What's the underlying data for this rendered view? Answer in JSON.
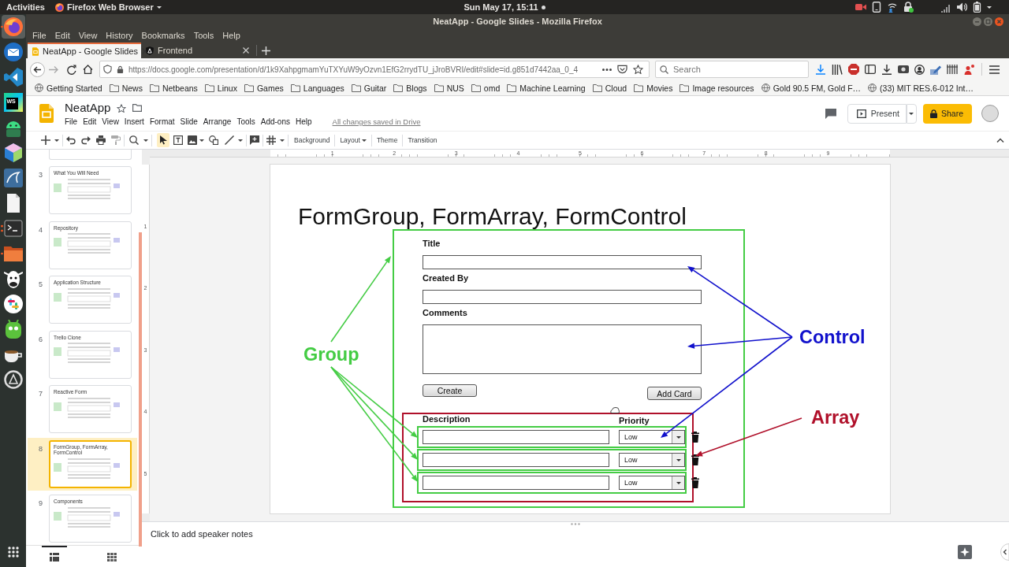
{
  "system_bar": {
    "activities": "Activities",
    "app_menu": "Firefox Web Browser",
    "clock": "Sun May 17, 15:11"
  },
  "dock": {
    "apps": [
      {
        "kind": "browser",
        "running": true,
        "multiple_windows": false,
        "selected": true
      },
      {
        "kind": "mail",
        "running": false,
        "multiple_windows": false,
        "selected": false
      },
      {
        "kind": "code-editor",
        "running": false,
        "multiple_windows": false,
        "selected": false
      },
      {
        "kind": "ide",
        "label": "WS",
        "running": false,
        "multiple_windows": false,
        "selected": false
      },
      {
        "kind": "android",
        "running": false,
        "multiple_windows": false,
        "selected": false
      },
      {
        "kind": "cube",
        "running": false,
        "multiple_windows": false,
        "selected": false
      },
      {
        "kind": "database",
        "running": false,
        "multiple_windows": false,
        "selected": false
      },
      {
        "kind": "document",
        "running": false,
        "multiple_windows": false,
        "selected": false
      },
      {
        "kind": "terminal",
        "running": true,
        "multiple_windows": true,
        "selected": false
      },
      {
        "kind": "files",
        "running": true,
        "multiple_windows": false,
        "selected": false
      },
      {
        "kind": "cow",
        "running": false,
        "multiple_windows": false,
        "selected": false
      },
      {
        "kind": "chat",
        "running": false,
        "multiple_windows": false,
        "selected": false
      },
      {
        "kind": "robot",
        "running": false,
        "multiple_windows": false,
        "selected": false
      },
      {
        "kind": "cup",
        "running": false,
        "multiple_windows": false,
        "selected": false
      },
      {
        "kind": "updater",
        "running": false,
        "multiple_windows": false,
        "selected": false
      }
    ]
  },
  "browser": {
    "window_title": "NeatApp - Google Slides - Mozilla Firefox",
    "menu": [
      "File",
      "Edit",
      "View",
      "History",
      "Bookmarks",
      "Tools",
      "Help"
    ],
    "tabs": [
      {
        "kind": "presentation",
        "title": "NeatApp - Google Slides",
        "selected": true
      },
      {
        "kind": "webapp",
        "title": "Frontend",
        "selected": false
      }
    ],
    "url": "https://docs.google.com/presentation/d/1k9XahpgmamYuTXYuW9yOzvn1EfG2rrydTU_jJroBVRI/edit#slide=id.g851d7442aa_0_4",
    "search": {
      "placeholder": "Search"
    },
    "bookmarks": [
      {
        "kind": "page",
        "label": "Getting Started"
      },
      {
        "kind": "folder",
        "label": "News"
      },
      {
        "kind": "folder",
        "label": "Netbeans"
      },
      {
        "kind": "folder",
        "label": "Linux"
      },
      {
        "kind": "folder",
        "label": "Games"
      },
      {
        "kind": "folder",
        "label": "Languages"
      },
      {
        "kind": "folder",
        "label": "Guitar"
      },
      {
        "kind": "folder",
        "label": "Blogs"
      },
      {
        "kind": "folder",
        "label": "NUS"
      },
      {
        "kind": "folder",
        "label": "omd"
      },
      {
        "kind": "folder",
        "label": "Machine Learning"
      },
      {
        "kind": "folder",
        "label": "Cloud"
      },
      {
        "kind": "folder",
        "label": "Movies"
      },
      {
        "kind": "folder",
        "label": "Image resources"
      },
      {
        "kind": "page",
        "label": "Gold 90.5 FM, Gold F…"
      },
      {
        "kind": "page",
        "label": "(33) MIT RES.6-012 Int…"
      }
    ]
  },
  "slides_app": {
    "doc_title": "NeatApp",
    "menu": [
      "File",
      "Edit",
      "View",
      "Insert",
      "Format",
      "Slide",
      "Arrange",
      "Tools",
      "Add-ons",
      "Help"
    ],
    "save_status": "All changes saved in Drive",
    "present": "Present",
    "share": "Share",
    "toolbar": {
      "select_tool": {
        "selected": true
      },
      "text_buttons": [
        {
          "label": "Background",
          "dropdown": false
        },
        {
          "label": "Layout",
          "dropdown": true
        },
        {
          "label": "Theme",
          "dropdown": false
        },
        {
          "label": "Transition",
          "dropdown": false
        }
      ]
    }
  },
  "rulers": {
    "horizontal": [
      "1",
      "2",
      "3",
      "4",
      "5",
      "6",
      "7",
      "8",
      "9"
    ],
    "vertical": [
      "1",
      "2",
      "3",
      "4",
      "5"
    ]
  },
  "filmstrip": {
    "slides": [
      {
        "number": "3",
        "title": "What You Will Need",
        "selected": false
      },
      {
        "number": "4",
        "title": "Repository",
        "selected": false
      },
      {
        "number": "5",
        "title": "Application Structure",
        "selected": false
      },
      {
        "number": "6",
        "title": "Trello Clone",
        "selected": false
      },
      {
        "number": "7",
        "title": "Reactive Form",
        "selected": false
      },
      {
        "number": "8",
        "title": "FormGroup, FormArray, FormControl",
        "selected": true
      },
      {
        "number": "9",
        "title": "Components",
        "selected": false
      }
    ],
    "views": [
      {
        "kind": "list",
        "selected": true
      },
      {
        "kind": "grid",
        "selected": false
      }
    ]
  },
  "slide": {
    "title": "FormGroup, FormArray, FormControl",
    "fields": [
      {
        "label": "Title",
        "kind": "input"
      },
      {
        "label": "Created By",
        "kind": "input"
      },
      {
        "label": "Comments",
        "kind": "textarea"
      }
    ],
    "buttons": [
      "Create",
      "Add Card"
    ],
    "array": {
      "columns": [
        "Description",
        "Priority"
      ],
      "rows": [
        {
          "priority": "Low"
        },
        {
          "priority": "Low"
        },
        {
          "priority": "Low"
        }
      ]
    },
    "annotations": [
      {
        "kind": "group",
        "label": "Group",
        "color": "#44cc44"
      },
      {
        "kind": "control",
        "label": "Control",
        "color": "#1111cc"
      },
      {
        "kind": "array",
        "label": "Array",
        "color": "#b0102a"
      }
    ]
  },
  "speaker_notes": {
    "placeholder": "Click to add speaker notes"
  }
}
